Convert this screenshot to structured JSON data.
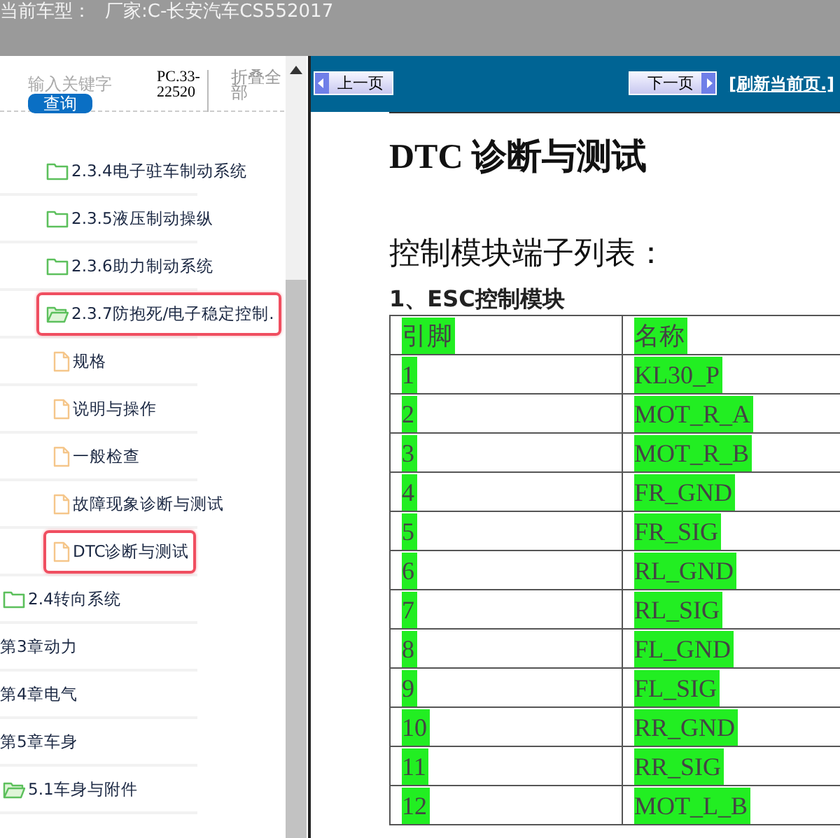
{
  "top_bar": {
    "label": "当前车型：",
    "value": "厂家:C-长安汽车CS552017"
  },
  "sidebar": {
    "search": {
      "placeholder": "输入关键字"
    },
    "search_button": "查询",
    "code": "PC.33-22520",
    "collapse_all": "折叠全部",
    "tree": [
      {
        "kind": "group",
        "children": [
          {
            "kind": "folder",
            "label": "2.3.4电子驻车制动系统",
            "expanded": false,
            "highlighted": false
          },
          {
            "kind": "folder",
            "label": "2.3.5液压制动操纵",
            "expanded": false,
            "highlighted": false
          },
          {
            "kind": "folder",
            "label": "2.3.6助力制动系统",
            "expanded": false,
            "highlighted": false
          },
          {
            "kind": "folder",
            "label": "2.3.7防抱死/电子稳定控制.",
            "expanded": true,
            "highlighted": true,
            "children": [
              {
                "kind": "file",
                "label": "规格",
                "highlighted": false
              },
              {
                "kind": "file",
                "label": "说明与操作",
                "highlighted": false
              },
              {
                "kind": "file",
                "label": "一般检查",
                "highlighted": false
              },
              {
                "kind": "file",
                "label": "故障现象诊断与测试",
                "highlighted": false
              },
              {
                "kind": "file",
                "label": "DTC诊断与测试",
                "highlighted": true
              }
            ]
          }
        ]
      },
      {
        "kind": "folder",
        "label": "2.4转向系统",
        "expanded": false,
        "highlighted": false
      },
      {
        "kind": "chapter",
        "label": "第3章动力",
        "highlighted": false
      },
      {
        "kind": "chapter",
        "label": "第4章电气",
        "highlighted": false
      },
      {
        "kind": "chapter",
        "label": "第5章车身",
        "highlighted": false
      },
      {
        "kind": "folder",
        "label": "5.1车身与附件",
        "expanded": true,
        "highlighted": false
      }
    ]
  },
  "nav": {
    "prev": "上一页",
    "next": "下一页",
    "refresh": "[刷新当前页.]"
  },
  "document": {
    "title": "DTC 诊断与测试",
    "subtitle": "控制模块端子列表：",
    "section": "1、ESC控制模块",
    "table": {
      "columns": [
        "引脚",
        "名称"
      ],
      "rows": [
        {
          "pin": "1",
          "name": "KL30_P"
        },
        {
          "pin": "2",
          "name": "MOT_R_A"
        },
        {
          "pin": "3",
          "name": "MOT_R_B"
        },
        {
          "pin": "4",
          "name": "FR_GND"
        },
        {
          "pin": "5",
          "name": "FR_SIG"
        },
        {
          "pin": "6",
          "name": "RL_GND"
        },
        {
          "pin": "7",
          "name": "RL_SIG"
        },
        {
          "pin": "8",
          "name": "FL_GND"
        },
        {
          "pin": "9",
          "name": "FL_SIG"
        },
        {
          "pin": "10",
          "name": "RR_GND"
        },
        {
          "pin": "11",
          "name": "RR_SIG"
        },
        {
          "pin": "12",
          "name": "MOT_L_B"
        }
      ]
    }
  }
}
